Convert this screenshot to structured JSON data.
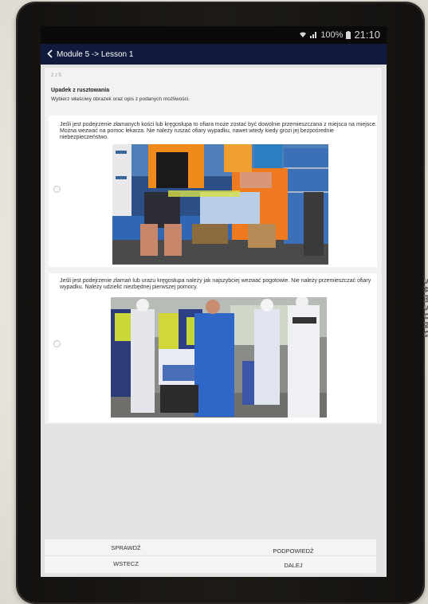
{
  "status": {
    "battery": "100%",
    "time": "21:10",
    "signal_icon": "signal-icon",
    "wifi_icon": "wifi-icon",
    "battery_icon": "battery-icon"
  },
  "brand": "SAMSUNG",
  "appbar": {
    "title": "Module 5 -> Lesson 1",
    "back_icon": "chevron-left-icon"
  },
  "question": {
    "counter": "2 z 5",
    "title": "Upadek z rusztowania",
    "instruction": "Wybierz właściwy obrazek oraz opis z podanych możliwości."
  },
  "options": [
    {
      "text": "Jeśli jest podejrzenie złamanych kości lub kręgosłupa to ofiara może zostać być dowolnie przemieszczana z miejsca na miejsce. Można wezwać na pomoc lekarza. Nie należy ruszać ofiary wypadku, nawet wtedy kiedy grozi jej bezpośrednie niebezpieczeństwo.",
      "image_label": "Robotnicy niosący poszkodowanego"
    },
    {
      "text": "Jeśli jest podejrzenie złamań lub urazu kręgosłupa należy jak najszybciej wezwać pogotowie. Nie należy przemieszczać ofiary wypadku. Należy udzielić niezbędnej pierwszej pomocy.",
      "image_label": "Ratownicy udzielający pomocy"
    }
  ],
  "buttons": {
    "check": "SPRAWDŹ",
    "hint": "PODPOWIEDŹ",
    "back": "WSTECZ",
    "next": "DALEJ"
  },
  "colors": {
    "appbar": "#101a3c",
    "statusbar": "#0a0a0a",
    "screen_bg": "#e3e3e3",
    "card_bg": "#ffffff"
  }
}
